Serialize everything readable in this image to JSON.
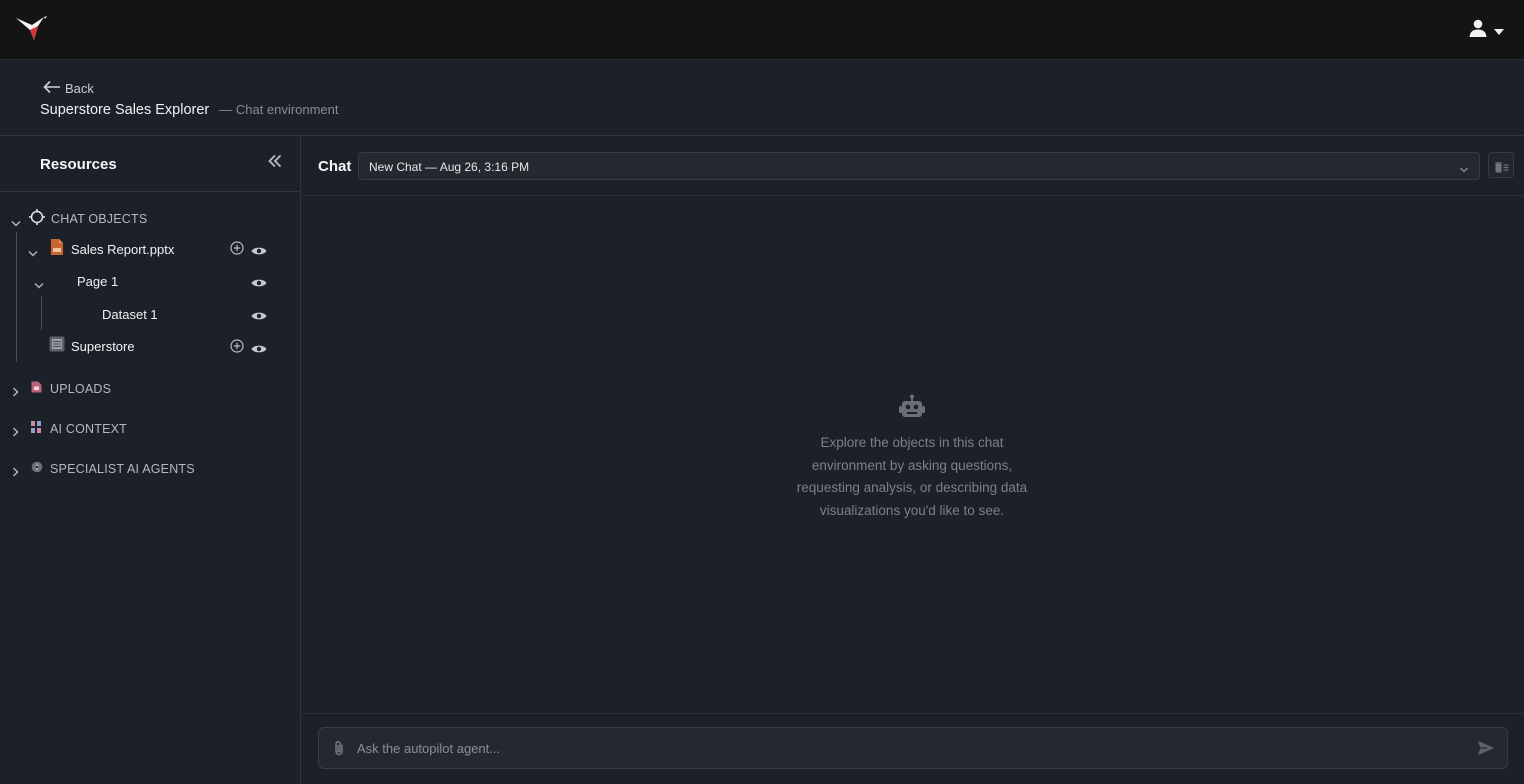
{
  "topbar": {
    "logo_icon": "hummingbird-logo-icon",
    "user_icon": "user-icon"
  },
  "header": {
    "back_label": "Back",
    "title": "Superstore Sales Explorer",
    "subtitle": "— Chat environment"
  },
  "sidebar": {
    "title": "Resources",
    "sections": [
      {
        "label": "CHAT OBJECTS",
        "icon": "crosshair-icon",
        "expanded": true
      },
      {
        "label": "UPLOADS",
        "icon": "upload-file-icon",
        "expanded": false
      },
      {
        "label": "AI CONTEXT",
        "icon": "ai-context-icon",
        "expanded": false
      },
      {
        "label": "SPECIALIST AI AGENTS",
        "icon": "agent-icon",
        "expanded": false
      }
    ],
    "tree": {
      "report": {
        "label": "Sales Report.pptx",
        "icon": "pptx-file-icon"
      },
      "page": {
        "label": "Page 1"
      },
      "dataset": {
        "label": "Dataset 1"
      },
      "superstore": {
        "label": "Superstore",
        "icon": "data-source-icon"
      }
    }
  },
  "chat": {
    "title": "Chat",
    "selected_chat": "New Chat — Aug 26, 3:16 PM",
    "empty_icon": "robot-icon",
    "empty_text": "Explore the objects in this chat environment by asking questions, requesting analysis, or describing data visualizations you'd like to see.",
    "composer_placeholder": "Ask the autopilot agent..."
  },
  "colors": {
    "topbar_bg": "#141414",
    "page_bg": "#1c2028",
    "logo_red": "#d6333a"
  }
}
